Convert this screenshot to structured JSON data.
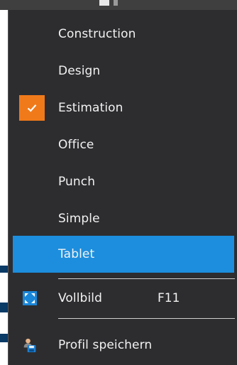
{
  "menu": {
    "items": [
      {
        "label": "Construction",
        "checked": false
      },
      {
        "label": "Design",
        "checked": false
      },
      {
        "label": "Estimation",
        "checked": true
      },
      {
        "label": "Office",
        "checked": false
      },
      {
        "label": "Punch",
        "checked": false
      },
      {
        "label": "Simple",
        "checked": false
      },
      {
        "label": "Tablet",
        "checked": false,
        "highlighted": true
      }
    ],
    "fullscreen": {
      "label": "Vollbild",
      "shortcut": "F11",
      "icon": "fullscreen-icon"
    },
    "save_profile": {
      "label": "Profil speichern",
      "icon": "profile-save-icon"
    }
  },
  "colors": {
    "menu_background": "#2d2d30",
    "highlight": "#1d8ede",
    "check_background": "#f07a1a",
    "text": "#f2f2f2"
  }
}
